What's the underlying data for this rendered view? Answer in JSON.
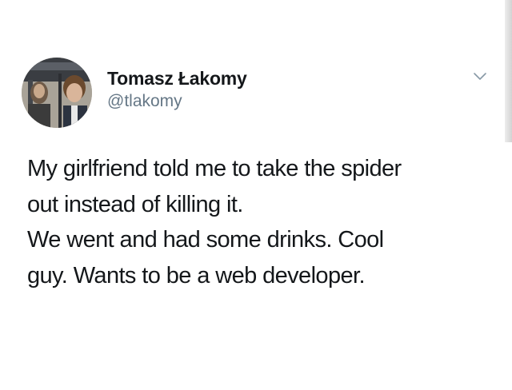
{
  "tweet": {
    "author": {
      "display_name": "Tomasz Łakomy",
      "handle": "@tlakomy",
      "avatar_icon": "profile-photo"
    },
    "menu_icon": "chevron-down-icon",
    "text_lines": [
      "My girlfriend told me to take the spider",
      "out instead of killing it.",
      "We went and had some drinks. Cool",
      "guy. Wants to be a web developer."
    ]
  },
  "colors": {
    "name": "#14171a",
    "handle": "#657786",
    "body_text": "#14171a",
    "background": "#ffffff"
  }
}
